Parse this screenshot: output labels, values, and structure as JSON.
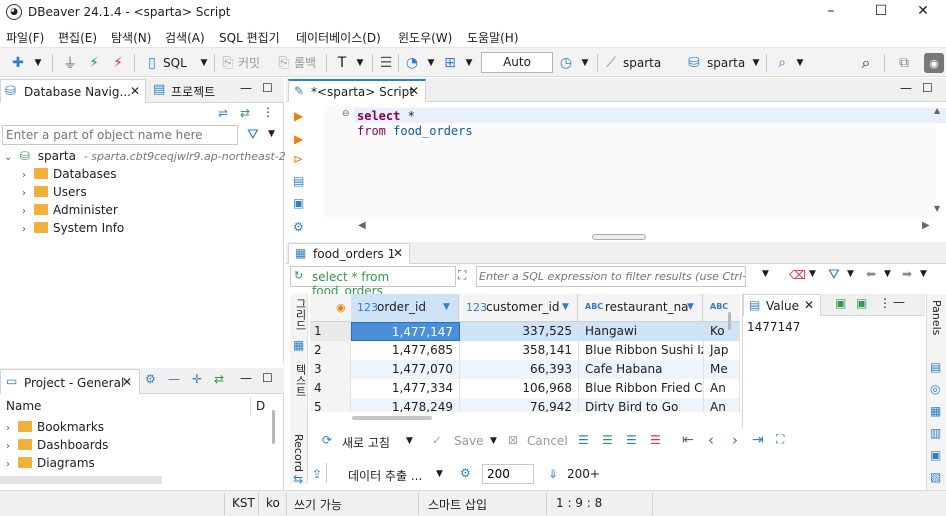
{
  "window": {
    "title": "DBeaver 24.1.4 - <sparta> Script",
    "min": "–",
    "max": "☐",
    "close": "✕"
  },
  "menu": [
    "파일(F)",
    "편집(E)",
    "탐색(N)",
    "검색(A)",
    "SQL 편집기",
    "데이터베이스(D)",
    "윈도우(W)",
    "도움말(H)"
  ],
  "toolbar": {
    "sql_label": "SQL",
    "commit_label": "커밋",
    "rollback_label": "롤백",
    "mode_value": "Auto",
    "connection": "sparta",
    "database": "sparta"
  },
  "navigator": {
    "tab_label": "Database Navig...",
    "projects_tab": "프로젝트",
    "filter_placeholder": "Enter a part of object name here",
    "connection_name": "sparta",
    "connection_host": "- sparta.cbt9ceqjwlr9.ap-northeast-2.r",
    "items": [
      "Databases",
      "Users",
      "Administer",
      "System Info"
    ]
  },
  "project": {
    "tab_label": "Project - General",
    "col_name": "Name",
    "col_d": "D",
    "items": [
      "Bookmarks",
      "Dashboards",
      "Diagrams"
    ]
  },
  "editor": {
    "tab_label": "*<sparta> Script",
    "line1_kw": "select",
    "line1_rest": " *",
    "line2_kw": "from",
    "line2_rest": " food_orders"
  },
  "results": {
    "tab_label": "food_orders 1",
    "query_label": "select * from food_orders",
    "filter_placeholder": "Enter a SQL expression to filter results (use Ctrl+",
    "side_grid": "그리드",
    "side_text": "텍스트",
    "side_record": "Record",
    "columns": [
      {
        "type": "123",
        "name": "order_id"
      },
      {
        "type": "123",
        "name": "customer_id"
      },
      {
        "type": "ABC",
        "name": "restaurant_na"
      },
      {
        "type": "ABC",
        "name": ""
      }
    ],
    "rows": [
      {
        "n": "1",
        "order_id": "1,477,147",
        "customer_id": "337,525",
        "restaurant": "Hangawi",
        "extra": "Ko"
      },
      {
        "n": "2",
        "order_id": "1,477,685",
        "customer_id": "358,141",
        "restaurant": "Blue Ribbon Sushi Izak",
        "extra": "Jap"
      },
      {
        "n": "3",
        "order_id": "1,477,070",
        "customer_id": "66,393",
        "restaurant": "Cafe Habana",
        "extra": "Me"
      },
      {
        "n": "4",
        "order_id": "1,477,334",
        "customer_id": "106,968",
        "restaurant": "Blue Ribbon Fried Chic",
        "extra": "An"
      },
      {
        "n": "5",
        "order_id": "1,478,249",
        "customer_id": "76,942",
        "restaurant": "Dirty Bird to Go",
        "extra": "An"
      }
    ],
    "value_tab": "Value",
    "value_content": "1477147",
    "panels_label": "Panels",
    "refresh_label": "새로 고침",
    "save_label": "Save",
    "cancel_label": "Cancel",
    "export_label": "데이터 추출 ...",
    "fetch_size": "200",
    "fetch_more": "200+"
  },
  "status": {
    "tz": "KST",
    "lang": "ko",
    "mode": "쓰기 가능",
    "insert": "스마트 삽입",
    "pos": "1 : 9 : 8"
  },
  "colors": {
    "accent": "#2f7ec8",
    "selected_row": "#cfe3f7",
    "selected_cell": "#4a90d9",
    "keyword": "#7f0055",
    "table_name": "#0a5c9e"
  }
}
